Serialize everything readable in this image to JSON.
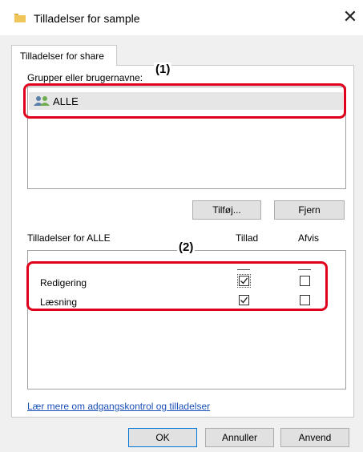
{
  "window": {
    "title": "Tilladelser for sample",
    "close_glyph": "✕"
  },
  "tabs": [
    {
      "label": "Tilladelser for share"
    }
  ],
  "groups": {
    "label": "Grupper eller brugernavne:",
    "items": [
      {
        "name": "ALLE",
        "icon": "users-icon"
      }
    ],
    "add_button": "Tilføj...",
    "remove_button": "Fjern"
  },
  "permissions": {
    "label": "Tilladelser for ALLE",
    "allow_header": "Tillad",
    "deny_header": "Afvis",
    "rows": [
      {
        "name": "Redigering",
        "allow": true,
        "deny": false
      },
      {
        "name": "Læsning",
        "allow": true,
        "deny": false
      }
    ]
  },
  "link_text": "Lær mere om adgangskontrol og tilladelser",
  "footer": {
    "ok": "OK",
    "cancel": "Annuller",
    "apply": "Anvend"
  },
  "annotations": {
    "marker1": "(1)",
    "marker2": "(2)",
    "color": "#e0001b"
  }
}
